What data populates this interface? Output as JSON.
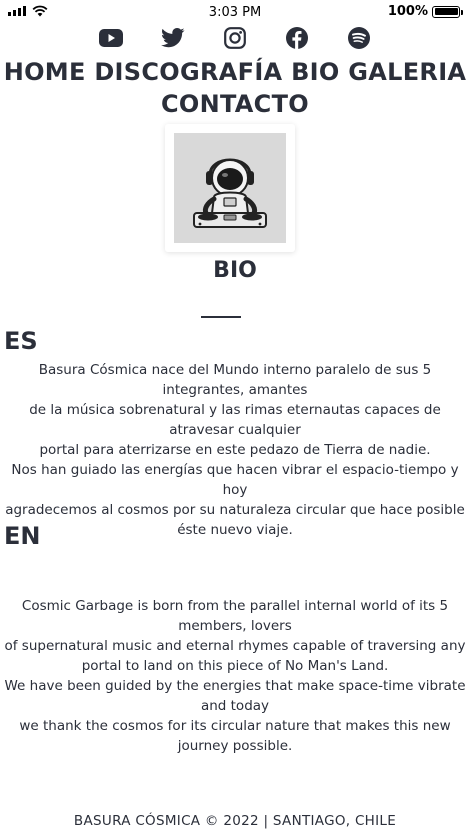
{
  "status_bar": {
    "time": "3:03 PM",
    "battery": "100%",
    "battery_level": 1.0
  },
  "social": [
    {
      "name": "youtube-icon"
    },
    {
      "name": "twitter-icon"
    },
    {
      "name": "instagram-icon"
    },
    {
      "name": "facebook-icon"
    },
    {
      "name": "spotify-icon"
    }
  ],
  "nav": {
    "home": "HOME",
    "discografia": "DISCOGRAFÍA",
    "bio": "BIO",
    "galeria": "GALERIA",
    "contacto": "CONTACTO"
  },
  "bio": {
    "title": "BIO",
    "rule": "___",
    "es_label": "ES",
    "en_label": "EN",
    "es_lines": [
      "Basura Cósmica nace del Mundo interno paralelo de sus 5 integrantes, amantes",
      "de la música sobrenatural y las rimas eternautas capaces de atravesar cualquier",
      "portal para aterrizarse en este pedazo de Tierra de nadie.",
      "Nos han guiado las energías que hacen vibrar el espacio-tiempo y hoy",
      "agradecemos al cosmos por su naturaleza circular que hace posible éste nuevo viaje."
    ],
    "en_lines": [
      "Cosmic Garbage is born from the parallel internal world of its 5 members, lovers",
      "of supernatural music and eternal rhymes capable of traversing any",
      "portal to land on this piece of No Man's Land.",
      "We have been guided by the energies that make space-time vibrate and today",
      "we thank the cosmos for its circular nature that makes this new journey possible."
    ]
  },
  "footer": {
    "text": "BASURA CÓSMICA  ©  2022 | SANTIAGO, CHILE"
  }
}
